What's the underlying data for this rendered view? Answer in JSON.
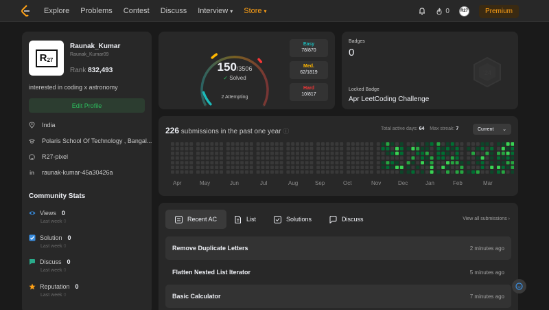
{
  "nav": {
    "links": [
      "Explore",
      "Problems",
      "Contest",
      "Discuss",
      "Interview",
      "Store"
    ],
    "streak_count": "0",
    "avatar_text": "R27",
    "premium_label": "Premium"
  },
  "profile": {
    "avatar_text": "R",
    "avatar_sub": "27",
    "name": "Raunak_Kumar",
    "handle": "Raunak_Kumar09",
    "rank_label": "Rank",
    "rank_value": "832,493",
    "bio": "interested in coding x astronomy",
    "edit_label": "Edit Profile",
    "location": "India",
    "school": "Polaris School Of Technology , Bangal...",
    "github": "R27-pixel",
    "linkedin": "raunak-kumar-45a30426a"
  },
  "community": {
    "title": "Community Stats",
    "views_label": "Views",
    "views_value": "0",
    "solution_label": "Solution",
    "solution_value": "0",
    "discuss_label": "Discuss",
    "discuss_value": "0",
    "reputation_label": "Reputation",
    "reputation_value": "0",
    "last_week_label": "Last week",
    "last_week_value": "0"
  },
  "solved": {
    "count": "150",
    "total": "/3506",
    "label": "Solved",
    "attempting": "2 Attempting",
    "easy_label": "Easy",
    "easy_count": "78/870",
    "medium_label": "Med.",
    "medium_count": "62/1819",
    "hard_label": "Hard",
    "hard_count": "10/817",
    "progress": {
      "easy": 0.0897,
      "medium": 0.0341,
      "hard": 0.0123
    }
  },
  "badges": {
    "label": "Badges",
    "count": "0",
    "locked_label": "Locked Badge",
    "locked_name": "Apr LeetCoding Challenge"
  },
  "heatmap": {
    "count": "226",
    "title_rest": " submissions in the past one year",
    "active_label": "Total active days:",
    "active_value": "64",
    "streak_label": "Max streak:",
    "streak_value": "7",
    "select_label": "Current",
    "months": [
      "Apr",
      "May",
      "Jun",
      "Jul",
      "Aug",
      "Sep",
      "Oct",
      "Nov",
      "Dec",
      "Jan",
      "Feb",
      "Mar"
    ],
    "colors": {
      "empty": "#393939",
      "l1": "#0e4429",
      "l2": "#006d32",
      "l3": "#26a641",
      "l4": "#39d353"
    }
  },
  "submissions": {
    "tabs": [
      "Recent AC",
      "List",
      "Solutions",
      "Discuss"
    ],
    "view_all": "View all submissions",
    "rows": [
      {
        "title": "Remove Duplicate Letters",
        "time": "2 minutes ago"
      },
      {
        "title": "Flatten Nested List Iterator",
        "time": "5 minutes ago"
      },
      {
        "title": "Basic Calculator",
        "time": "7 minutes ago"
      }
    ]
  }
}
